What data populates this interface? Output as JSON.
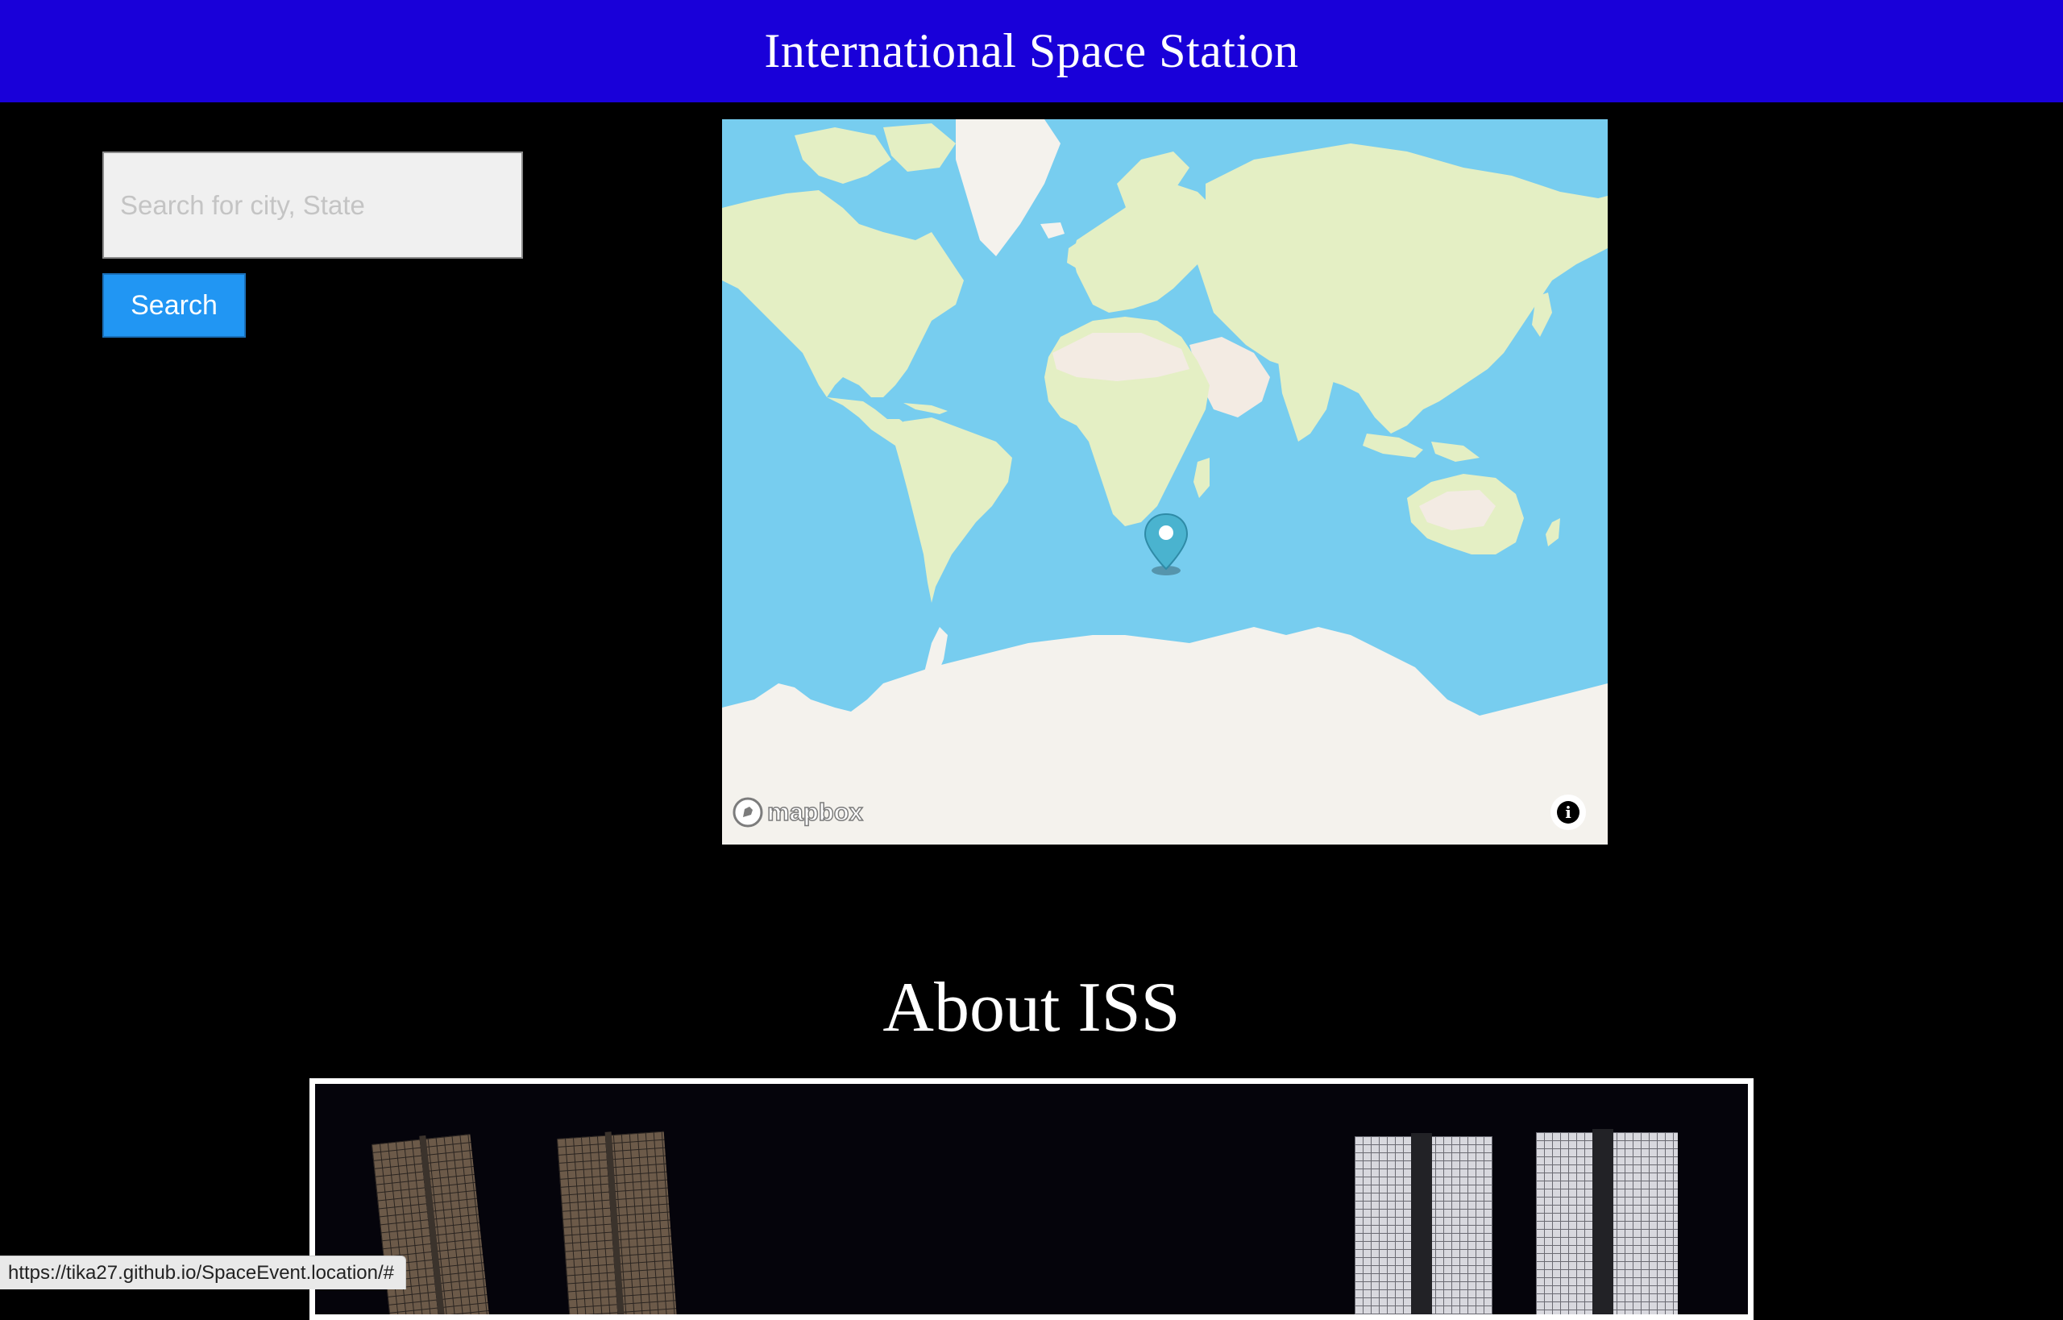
{
  "header": {
    "title": "International Space Station"
  },
  "search": {
    "placeholder": "Search for city, State",
    "button_label": "Search"
  },
  "map": {
    "attribution_logo": "mapbox",
    "info_icon": "info-icon",
    "marker_icon": "map-pin-icon"
  },
  "about": {
    "heading": "About ISS"
  },
  "status_bar": {
    "url": "https://tika27.github.io/SpaceEvent.location/#"
  },
  "colors": {
    "header_bg": "#1900d9",
    "page_bg": "#000000",
    "button_bg": "#2196f3",
    "ocean": "#77cdef",
    "land": "#e4efc4",
    "desert": "#f3ebe3",
    "ice": "#f4f2ed",
    "pin": "#4ab3cf"
  }
}
